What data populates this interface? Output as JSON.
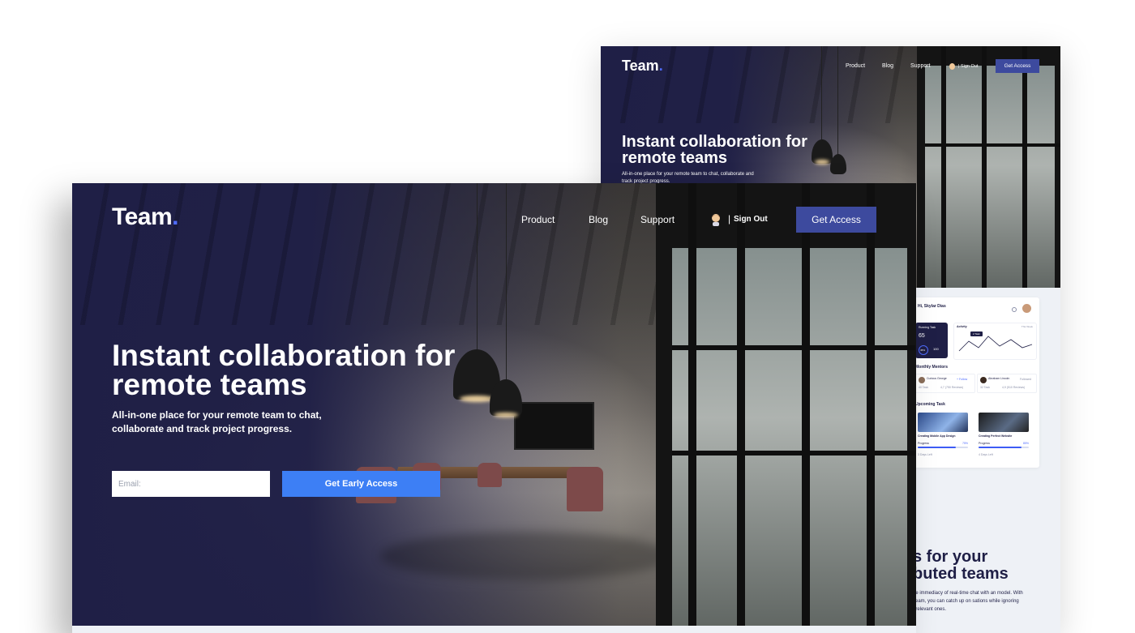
{
  "hero": {
    "logo_text": "Team",
    "logo_dot": ".",
    "nav": {
      "product": "Product",
      "blog": "Blog",
      "support": "Support"
    },
    "divider": "|",
    "sign_out": "Sign Out",
    "cta": "Get Access",
    "headline": "Instant collaboration for remote teams",
    "subheadline": "All-in-one place for your remote team to chat, collaborate and track project progress.",
    "email_placeholder": "Email:",
    "submit": "Get Early Access"
  },
  "back_preview": {
    "logo_text": "Team",
    "logo_dot": ".",
    "nav": {
      "product": "Product",
      "blog": "Blog",
      "support": "Support"
    },
    "sign_out": "| Sign Out",
    "cta": "Get Access",
    "headline": "Instant collaboration for remote teams",
    "subheadline": "All-in-one place for your remote team to chat, collaborate and track project progress.",
    "dashboard": {
      "greeting": "Hi, Skylar Dias",
      "running_task_label": "Running Task",
      "running_task_value": "65",
      "running_percent": "45%",
      "running_total": "100",
      "activity_label": "Activity",
      "activity_range": "This Week",
      "activity_tooltip": "2 Task",
      "monthly_mentors_label": "Monthly Mentors",
      "mentors": [
        {
          "name": "Curious George",
          "follow": "+ Follow",
          "tasks": "40 Task",
          "reviews": "4,7 (750 Reviews)"
        },
        {
          "name": "Abraham Lincoln",
          "follow": "Followed",
          "tasks": "32 Task",
          "reviews": "4,9 (510 Reviews)"
        }
      ],
      "upcoming_task_label": "Upcoming Task",
      "tasks": [
        {
          "title": "Creating Mobile App Design",
          "progress_label": "Progress",
          "progress_value": "75%",
          "progress": 0.75,
          "days_left": "3 Days Left"
        },
        {
          "title": "Creating Perfect Website",
          "progress_label": "Progress",
          "progress_value": "85%",
          "progress": 0.85,
          "days_left": "4 Days Left"
        }
      ]
    },
    "features_heading_line1": "s for your",
    "features_heading_line2": "buted teams",
    "features_text": "he immediacy of real-time chat with an model. With Team, you can catch up on sations while ignoring irrelevant ones."
  },
  "colors": {
    "navy": "#1f1f46",
    "accent_dot": "#4f6cff",
    "cta_bg": "#3d4a9e",
    "submit_bg": "#3d7ff5",
    "light_bg": "#eef1f6"
  }
}
